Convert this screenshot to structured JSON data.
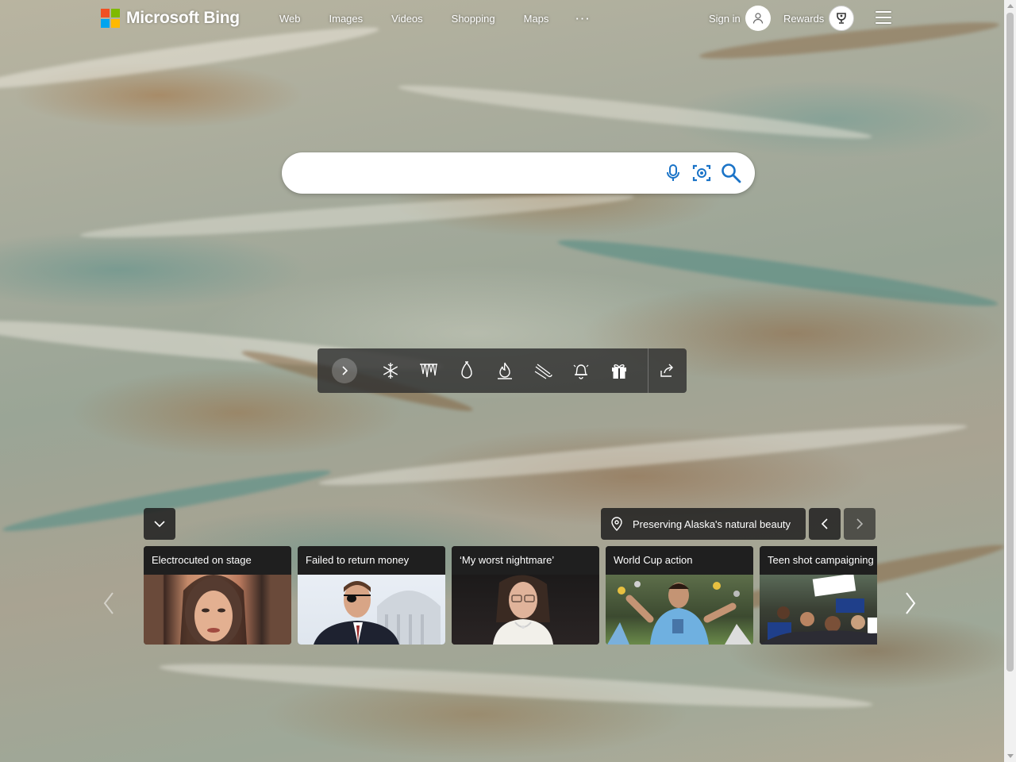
{
  "brand": {
    "name": "Microsoft Bing"
  },
  "nav": {
    "web": "Web",
    "images": "Images",
    "videos": "Videos",
    "shopping": "Shopping",
    "maps": "Maps",
    "more": "···"
  },
  "header": {
    "signin_label": "Sign in",
    "rewards_label": "Rewards"
  },
  "search": {
    "value": "",
    "placeholder": ""
  },
  "toolbar": {
    "icons": [
      "chevron-right-icon",
      "snowflake-icon",
      "icicles-icon",
      "ornament-icon",
      "fire-icon",
      "sled-icon",
      "bell-icon",
      "gift-icon",
      "share-icon"
    ]
  },
  "image_of_day": {
    "location_text": "Preserving Alaska's natural beauty"
  },
  "news": {
    "cards": [
      {
        "title": "Electrocuted on stage"
      },
      {
        "title": "Failed to return money"
      },
      {
        "title": "‘My worst nightmare’"
      },
      {
        "title": "World Cup action"
      },
      {
        "title": "Teen shot campaigning"
      }
    ]
  },
  "colors": {
    "ms_red": "#f25022",
    "ms_green": "#7fba00",
    "ms_blue": "#00a4ef",
    "ms_yellow": "#ffb900",
    "search_icon_blue": "#1a73c7"
  }
}
